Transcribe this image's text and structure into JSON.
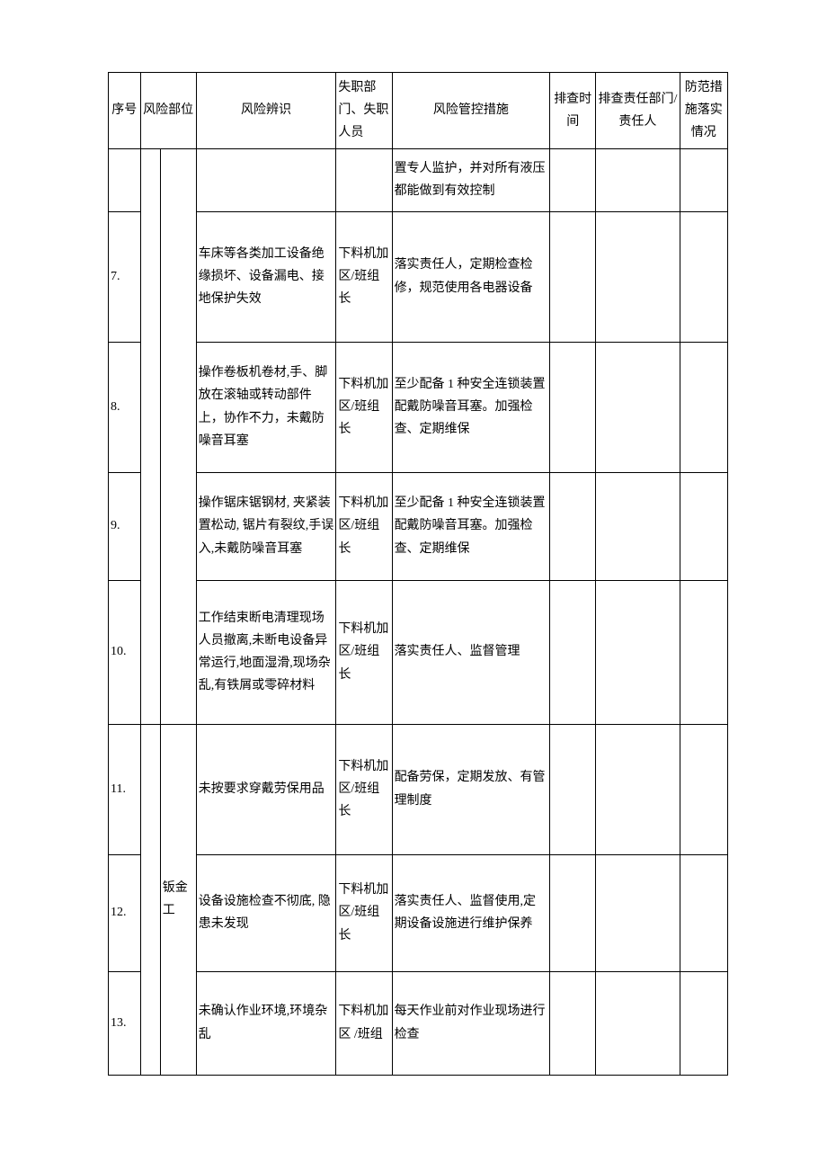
{
  "headers": {
    "seq": "序号",
    "loc": "风险部位",
    "risk": "风险辨识",
    "dept": "失职部门、失职人员",
    "ctrl": "风险管控措施",
    "time": "排查时间",
    "resp": "排查责任部门/责任人",
    "stat": "防范措施落实情况"
  },
  "loc_group": "钣金工",
  "rows": [
    {
      "seq": "",
      "risk": "",
      "dept": "",
      "ctrl": "置专人监护，并对所有液压都能做到有效控制",
      "time": "",
      "resp": "",
      "stat": ""
    },
    {
      "seq": "7.",
      "risk": "车床等各类加工设备绝缘损坏、设备漏电、接地保护失效",
      "dept": "下料机加区/班组长",
      "ctrl": "落实责任人，定期检查检修，规范使用各电器设备",
      "time": "",
      "resp": "",
      "stat": ""
    },
    {
      "seq": "8.",
      "risk": "操作卷板机卷材,手、脚放在滚轴或转动部件上，协作不力，未戴防噪音耳塞",
      "dept": "下料机加区/班组长",
      "ctrl": "至少配备 1 种安全连锁装置 配戴防噪音耳塞。加强检查、定期维保",
      "time": "",
      "resp": "",
      "stat": ""
    },
    {
      "seq": "9.",
      "risk": "操作锯床锯钢材, 夹紧装置松动, 锯片有裂纹,手误入,未戴防噪音耳塞",
      "dept": "下料机加区/班组长",
      "ctrl": "至少配备 1 种安全连锁装置 配戴防噪音耳塞。加强检查、定期维保",
      "time": "",
      "resp": "",
      "stat": ""
    },
    {
      "seq": "10.",
      "risk": "工作结束断电清理现场人员撤离,未断电设备异常运行,地面湿滑,现场杂乱,有铁屑或零碎材料",
      "dept": "下料机加区/班组长",
      "ctrl": "落实责任人、监督管理",
      "time": "",
      "resp": "",
      "stat": ""
    },
    {
      "seq": "11.",
      "risk": "未按要求穿戴劳保用品",
      "dept": "下料机加区/班组长",
      "ctrl": "配备劳保，定期发放、有管理制度",
      "time": "",
      "resp": "",
      "stat": ""
    },
    {
      "seq": "12.",
      "risk": "设备设施检查不彻底, 隐患未发现",
      "dept": "下料机加区/班组长",
      "ctrl": "落实责任人、监督使用,定期设备设施进行维护保养",
      "time": "",
      "resp": "",
      "stat": ""
    },
    {
      "seq": "13.",
      "risk": "未确认作业环境,环境杂乱",
      "dept": "下料机加 区 /班组",
      "ctrl": "每天作业前对作业现场进行检查",
      "time": "",
      "resp": "",
      "stat": ""
    }
  ]
}
